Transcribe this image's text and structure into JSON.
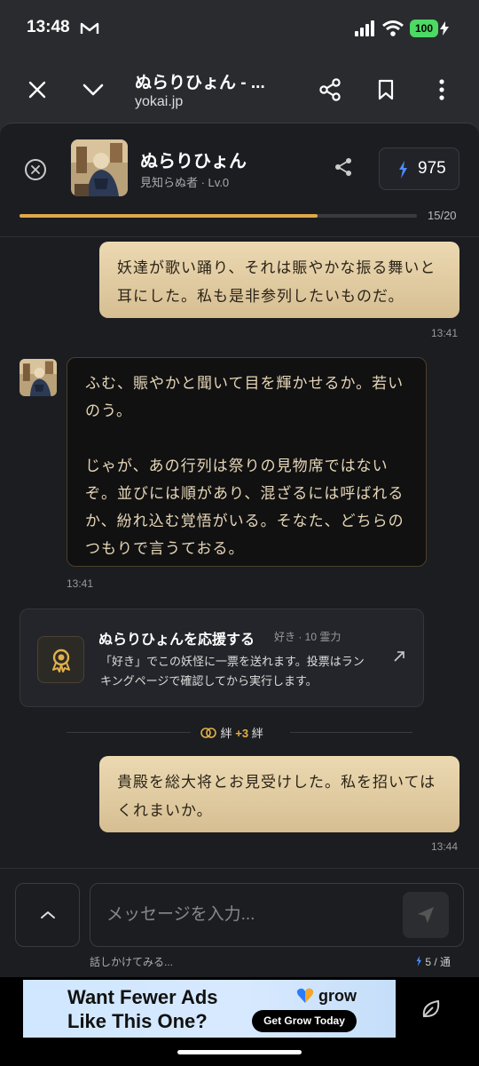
{
  "status": {
    "time": "13:48",
    "battery": "100",
    "icons": [
      "mail-icon",
      "signal-icon",
      "wifi-icon",
      "charging-icon"
    ]
  },
  "browser": {
    "title": "ぬらりひょん - ...",
    "url": "yokai.jp"
  },
  "header": {
    "name": "ぬらりひょん",
    "subtitle": "見知らぬ者 · Lv.0",
    "points": "975",
    "progress_text": "15/20",
    "progress_fraction": 0.75
  },
  "messages": [
    {
      "role": "user",
      "text": "妖達が歌い踊り、それは賑やかな振る舞いと耳にした。私も是非参列したいものだ。",
      "time": "13:41"
    },
    {
      "role": "bot",
      "paragraphs": [
        "ふむ、賑やかと聞いて目を輝かせるか。若いのう。",
        "じゃが、あの行列は祭りの見物席ではないぞ。並びには順があり、混ざるには呼ばれるか、紛れ込む覚悟がいる。そなた、どちらのつもりで言うておる。"
      ],
      "time": "13:41"
    },
    {
      "role": "user",
      "text": "貴殿を総大将とお見受けした。私を招いてはくれまいか。",
      "time": "13:44"
    }
  ],
  "support": {
    "title": "ぬらりひょんを応援する",
    "tag": "好き · 10 霊力",
    "desc": "「好き」でこの妖怪に一票を送れます。投票はランキングページで確認してから実行します。"
  },
  "bond": {
    "label": "絆",
    "plus": "+3",
    "unit": "絆"
  },
  "composer": {
    "placeholder": "メッセージを入力...",
    "hint": "話しかけてみる...",
    "cost": "5 / 通"
  },
  "ad": {
    "headline_1": "Want Fewer Ads",
    "headline_2": "Like This One?",
    "brand": "grow",
    "cta": "Get Grow Today"
  },
  "colors": {
    "accent": "#e0a94a",
    "user_bubble": "#e4cfa6",
    "bot_text": "#e6d6b6",
    "ad_bg": "#cfe7ff"
  }
}
